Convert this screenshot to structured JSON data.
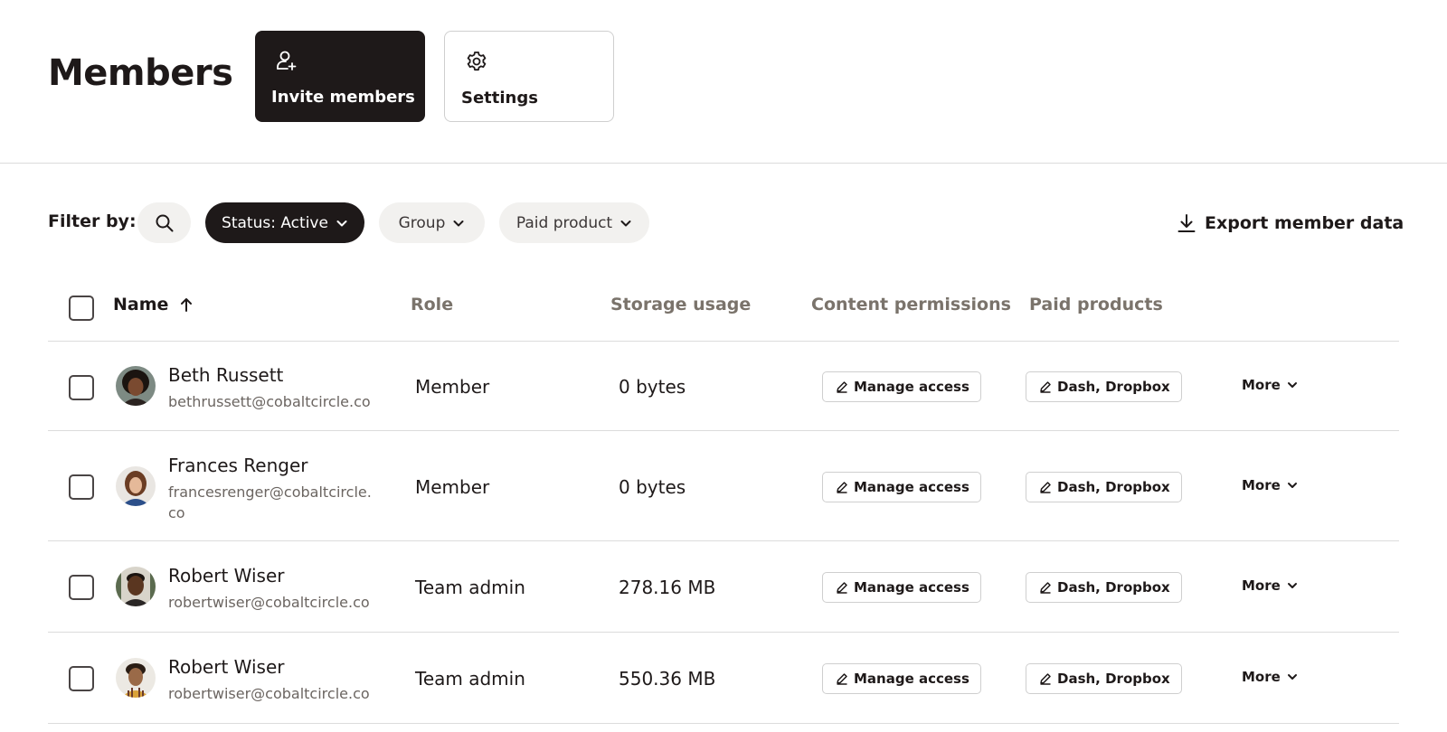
{
  "header": {
    "title": "Members",
    "invite_label": "Invite members",
    "settings_label": "Settings"
  },
  "filters": {
    "label": "Filter by:",
    "status": "Status: Active",
    "group": "Group",
    "paid_product": "Paid product",
    "export_label": "Export member data"
  },
  "table": {
    "columns": [
      "Name",
      "Role",
      "Storage usage",
      "Content permissions",
      "Paid products"
    ],
    "rows": [
      {
        "name": "Beth Russett",
        "email": "bethrussett@cobaltcircle.co",
        "role": "Member",
        "storage": "0 bytes",
        "permissions": "Manage access",
        "products": "Dash, Dropbox",
        "more": "More"
      },
      {
        "name": "Frances Renger",
        "email": "francesrenger@cobaltcircle.co",
        "role": "Member",
        "storage": "0 bytes",
        "permissions": "Manage access",
        "products": "Dash, Dropbox",
        "more": "More"
      },
      {
        "name": "Robert Wiser",
        "email": "robertwiser@cobaltcircle.co",
        "role": "Team admin",
        "storage": "278.16 MB",
        "permissions": "Manage access",
        "products": "Dash, Dropbox",
        "more": "More"
      },
      {
        "name": "Robert Wiser",
        "email": "robertwiser@cobaltcircle.co",
        "role": "Team admin",
        "storage": "550.36 MB",
        "permissions": "Manage access",
        "products": "Dash, Dropbox",
        "more": "More"
      }
    ]
  },
  "colors": {
    "primary_dark": "#1e1919",
    "pill_bg": "#f2f1ef",
    "muted_text": "#7a736b",
    "border": "#dcdcdc"
  },
  "icons": [
    "add-person-icon",
    "gear-icon",
    "search-icon",
    "chevron-down-icon",
    "download-icon",
    "arrow-up-icon",
    "pencil-icon"
  ]
}
